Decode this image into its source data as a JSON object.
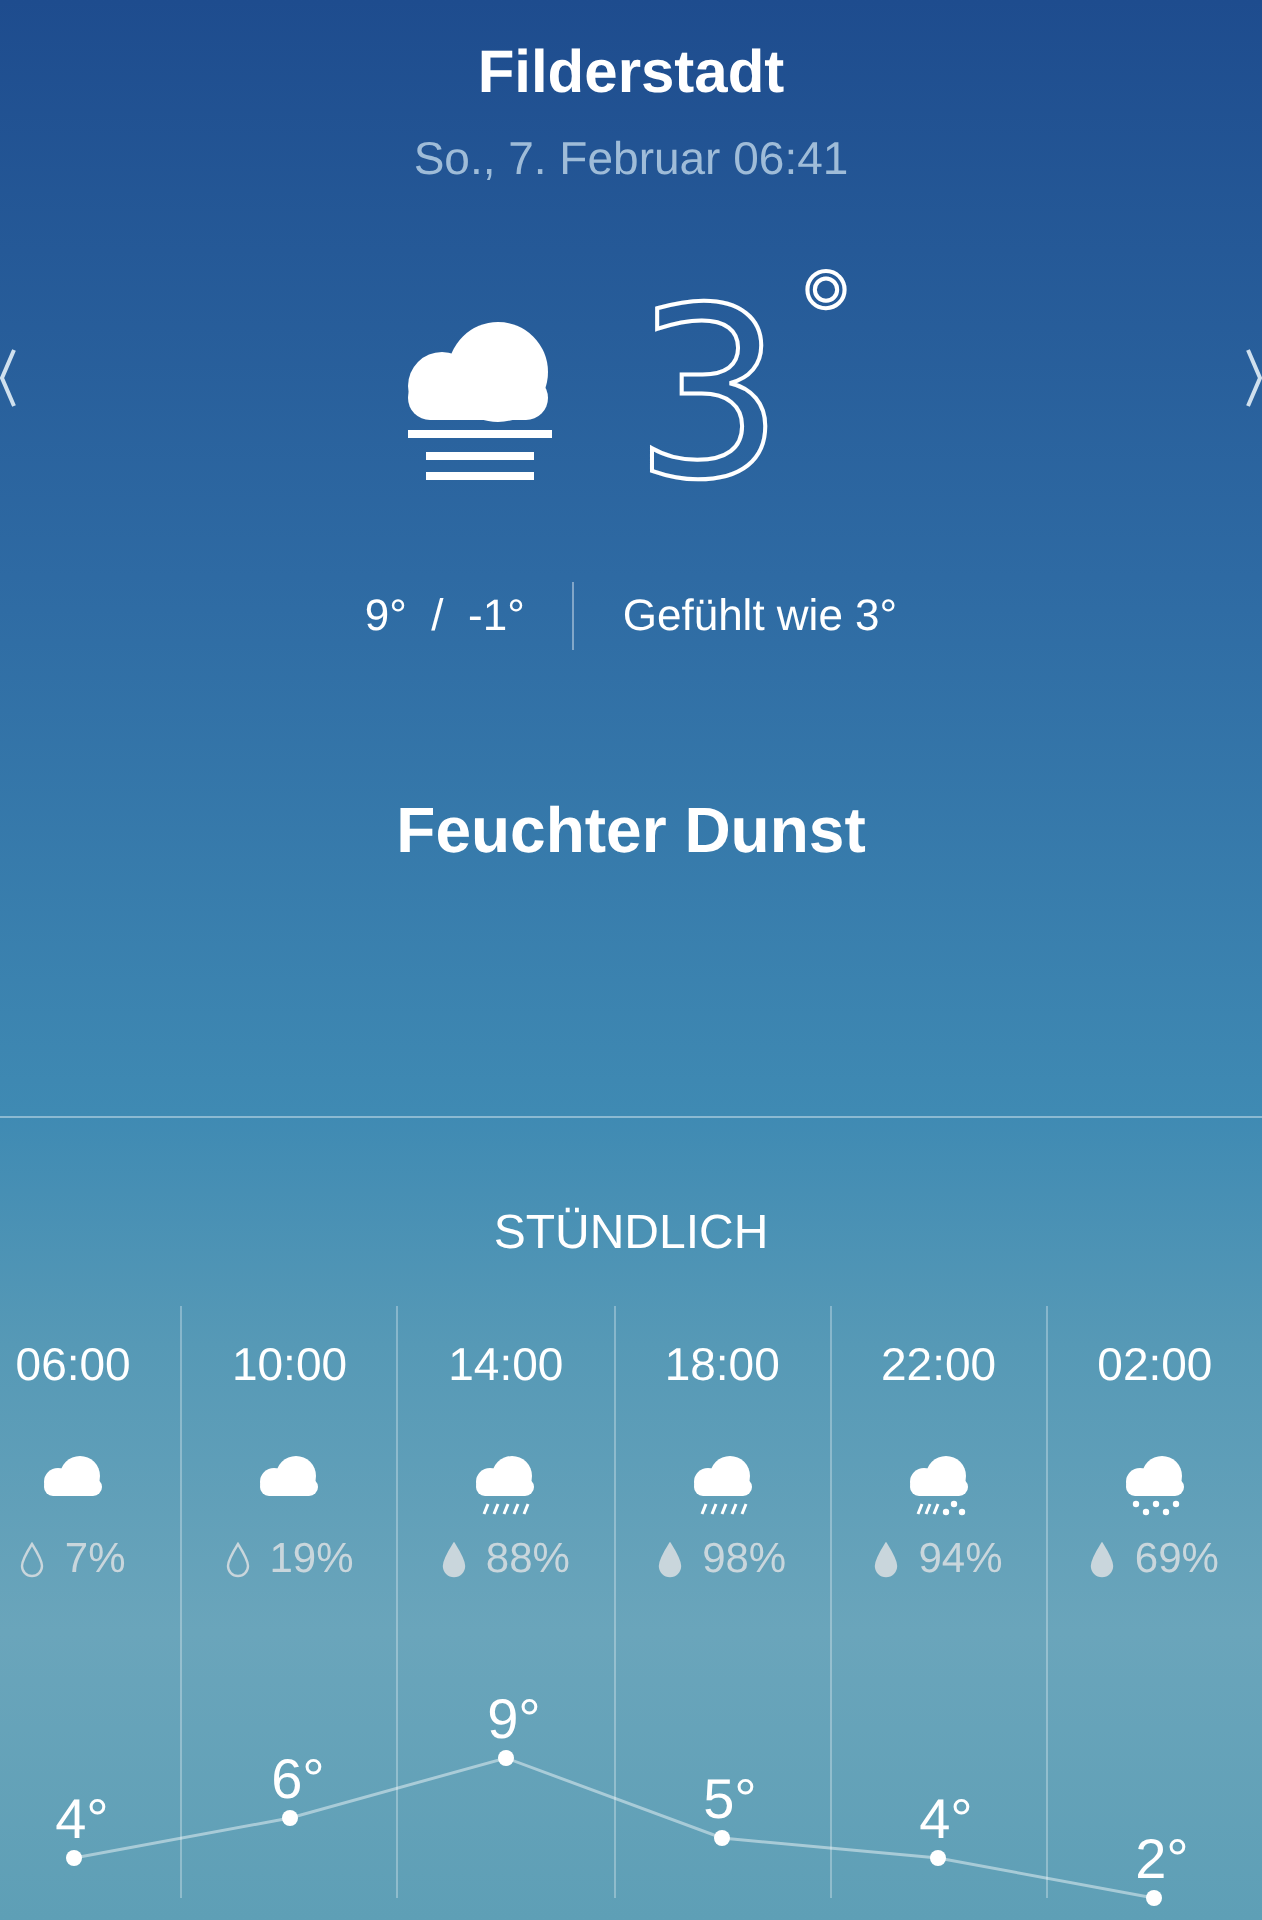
{
  "header": {
    "city": "Filderstadt",
    "datetime": "So., 7. Februar 06:41"
  },
  "current": {
    "kind": "fog",
    "temperature": "3",
    "degree": "°",
    "high_low": "9°  /  -1°",
    "feels_like": "Gefühlt wie 3°",
    "condition": "Feuchter Dunst"
  },
  "hourly": {
    "title": "STÜNDLICH",
    "items": [
      {
        "time": "06:00",
        "kind": "cloud",
        "drop_filled": false,
        "precip": "7%"
      },
      {
        "time": "10:00",
        "kind": "cloud",
        "drop_filled": false,
        "precip": "19%"
      },
      {
        "time": "14:00",
        "kind": "rain",
        "drop_filled": true,
        "precip": "88%"
      },
      {
        "time": "18:00",
        "kind": "rain",
        "drop_filled": true,
        "precip": "98%"
      },
      {
        "time": "22:00",
        "kind": "sleet",
        "drop_filled": true,
        "precip": "94%"
      },
      {
        "time": "02:00",
        "kind": "snow",
        "drop_filled": true,
        "precip": "69%"
      }
    ],
    "chart_data": {
      "type": "line",
      "series": [
        {
          "color": "#ffffff",
          "marker": "circle",
          "values": [
            4,
            6,
            9,
            5,
            4,
            2
          ],
          "value_labels": [
            "4°",
            "6°",
            "9°",
            "5°",
            "4°",
            "2°"
          ]
        }
      ]
    }
  }
}
